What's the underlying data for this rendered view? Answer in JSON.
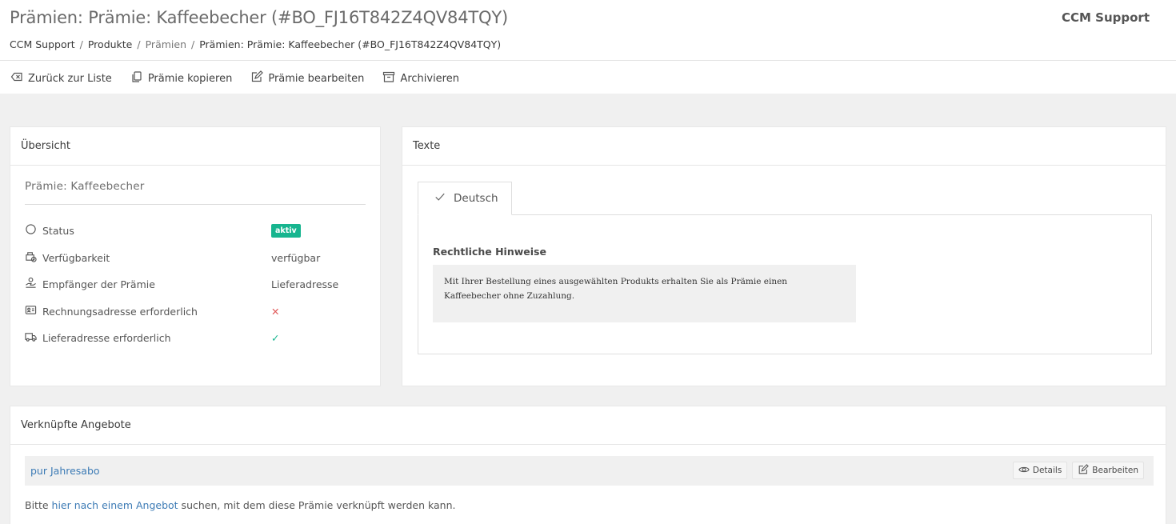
{
  "header": {
    "title": "Prämien: Prämie: Kaffeebecher (#BO_FJ16T842Z4QV84TQY)",
    "user": "CCM Support",
    "breadcrumb": [
      "CCM Support",
      "Produkte",
      "Prämien",
      "Prämien: Prämie: Kaffeebecher (#BO_FJ16T842Z4QV84TQY)"
    ]
  },
  "actions": [
    {
      "label": "Zurück zur Liste",
      "icon": "backspace-icon"
    },
    {
      "label": "Prämie kopieren",
      "icon": "copy-icon"
    },
    {
      "label": "Prämie bearbeiten",
      "icon": "edit-icon"
    },
    {
      "label": "Archivieren",
      "icon": "archive-icon"
    }
  ],
  "overview": {
    "heading": "Übersicht",
    "title": "Prämie: Kaffeebecher",
    "rows": [
      {
        "label": "Status",
        "value": "aktiv",
        "icon": "circle-icon"
      },
      {
        "label": "Verfügbarkeit",
        "value": "verfügbar",
        "icon": "availability-icon"
      },
      {
        "label": "Empfänger der Prämie",
        "value": "Lieferadresse",
        "icon": "recipient-icon"
      },
      {
        "label": "Rechnungsadresse erforderlich",
        "value": "✕",
        "icon": "id-card-icon"
      },
      {
        "label": "Lieferadresse erforderlich",
        "value": "✓",
        "icon": "truck-icon"
      }
    ],
    "colors": {
      "badge": "#17b58f",
      "cross": "#e05a5a",
      "check": "#17b58f"
    }
  },
  "texte": {
    "heading": "Texte",
    "tab_label": "Deutsch",
    "legal_title": "Rechtliche Hinweise",
    "legal_text": "Mit Ihrer Bestellung eines ausgewählten Produkts erhalten Sie als Prämie einen Kaffeebecher ohne Zuzahlung."
  },
  "angebote": {
    "heading": "Verknüpfte Angebote",
    "offer": "pur Jahresabo",
    "details_label": "Details",
    "edit_label": "Bearbeiten",
    "hint_prefix": "Bitte ",
    "hint_link": "hier nach einem Angebot",
    "hint_suffix": " suchen, mit dem diese Prämie verknüpft werden kann."
  }
}
